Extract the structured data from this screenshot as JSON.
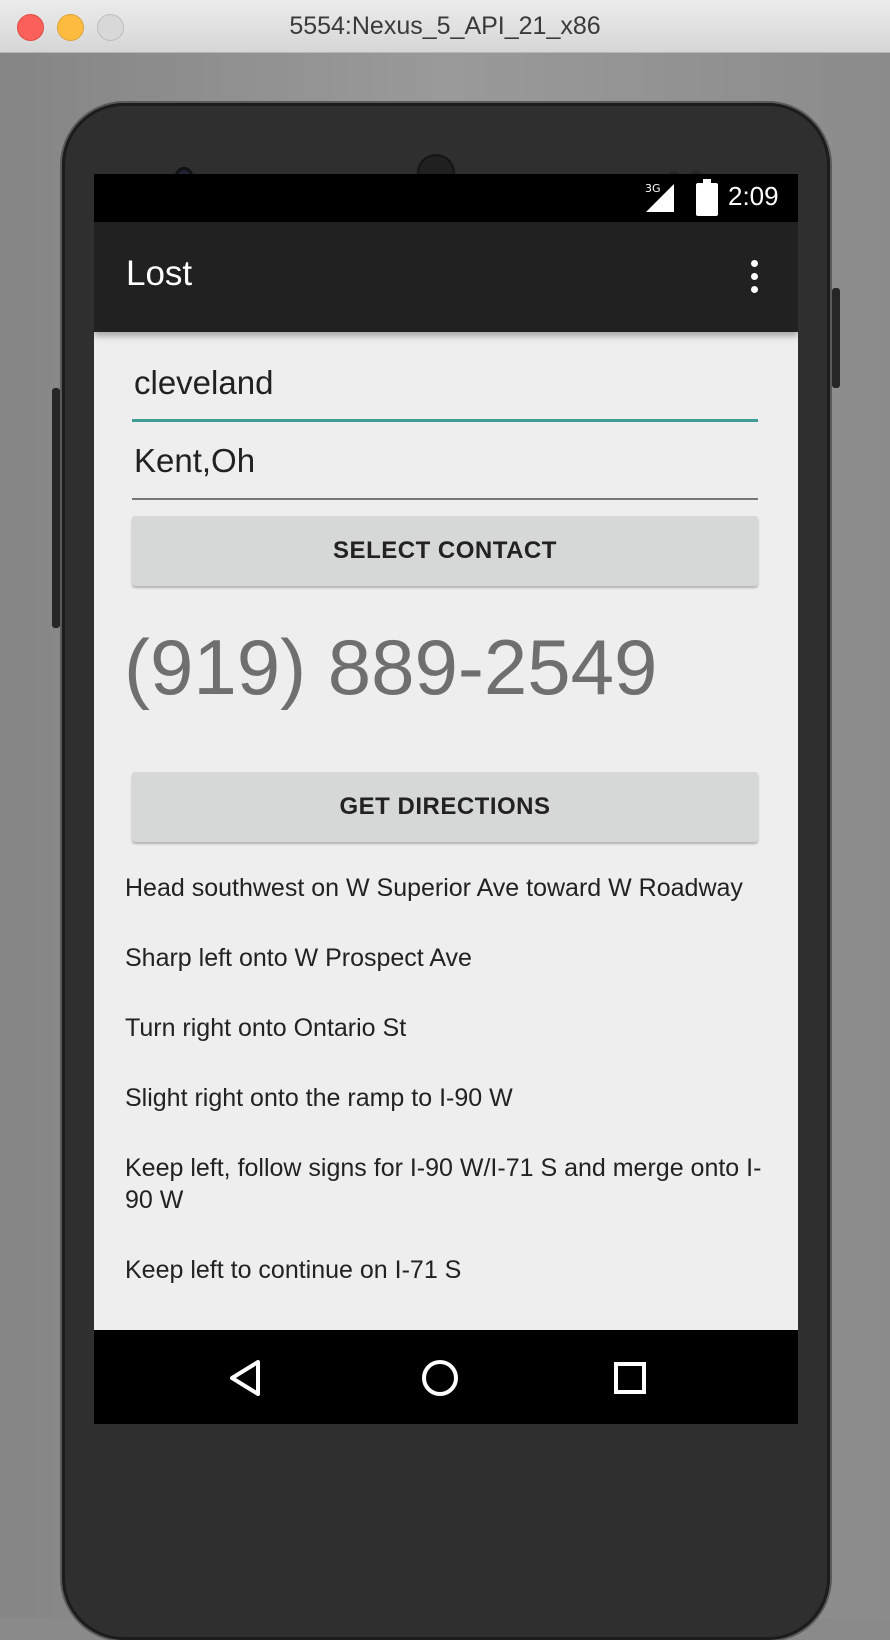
{
  "window": {
    "title": "5554:Nexus_5_API_21_x86"
  },
  "status_bar": {
    "network": "3G",
    "time": "2:09"
  },
  "app_bar": {
    "title": "Lost",
    "overflow_icon": "more-vert-icon"
  },
  "form": {
    "origin_value": "cleveland",
    "destination_value": "Kent,Oh",
    "select_contact_label": "SELECT CONTACT",
    "contact_phone": "(919) 889-2549",
    "get_directions_label": "GET DIRECTIONS"
  },
  "directions": [
    "Head southwest on W Superior Ave toward W Roadway",
    "Sharp left onto W Prospect Ave",
    "Turn right onto Ontario St",
    "Slight right onto the ramp to I-90 W",
    "Keep left, follow signs for I-90 W/I-71 S and merge onto I-90 W",
    "Keep left to continue on I-71 S"
  ],
  "nav_bar": {
    "back_icon": "back-triangle-icon",
    "home_icon": "home-circle-icon",
    "recents_icon": "recents-square-icon"
  },
  "colors": {
    "accent": "#3f9c94",
    "app_bar": "#212121",
    "screen_bg": "#eeeeee",
    "button_bg": "#d6d7d7"
  }
}
